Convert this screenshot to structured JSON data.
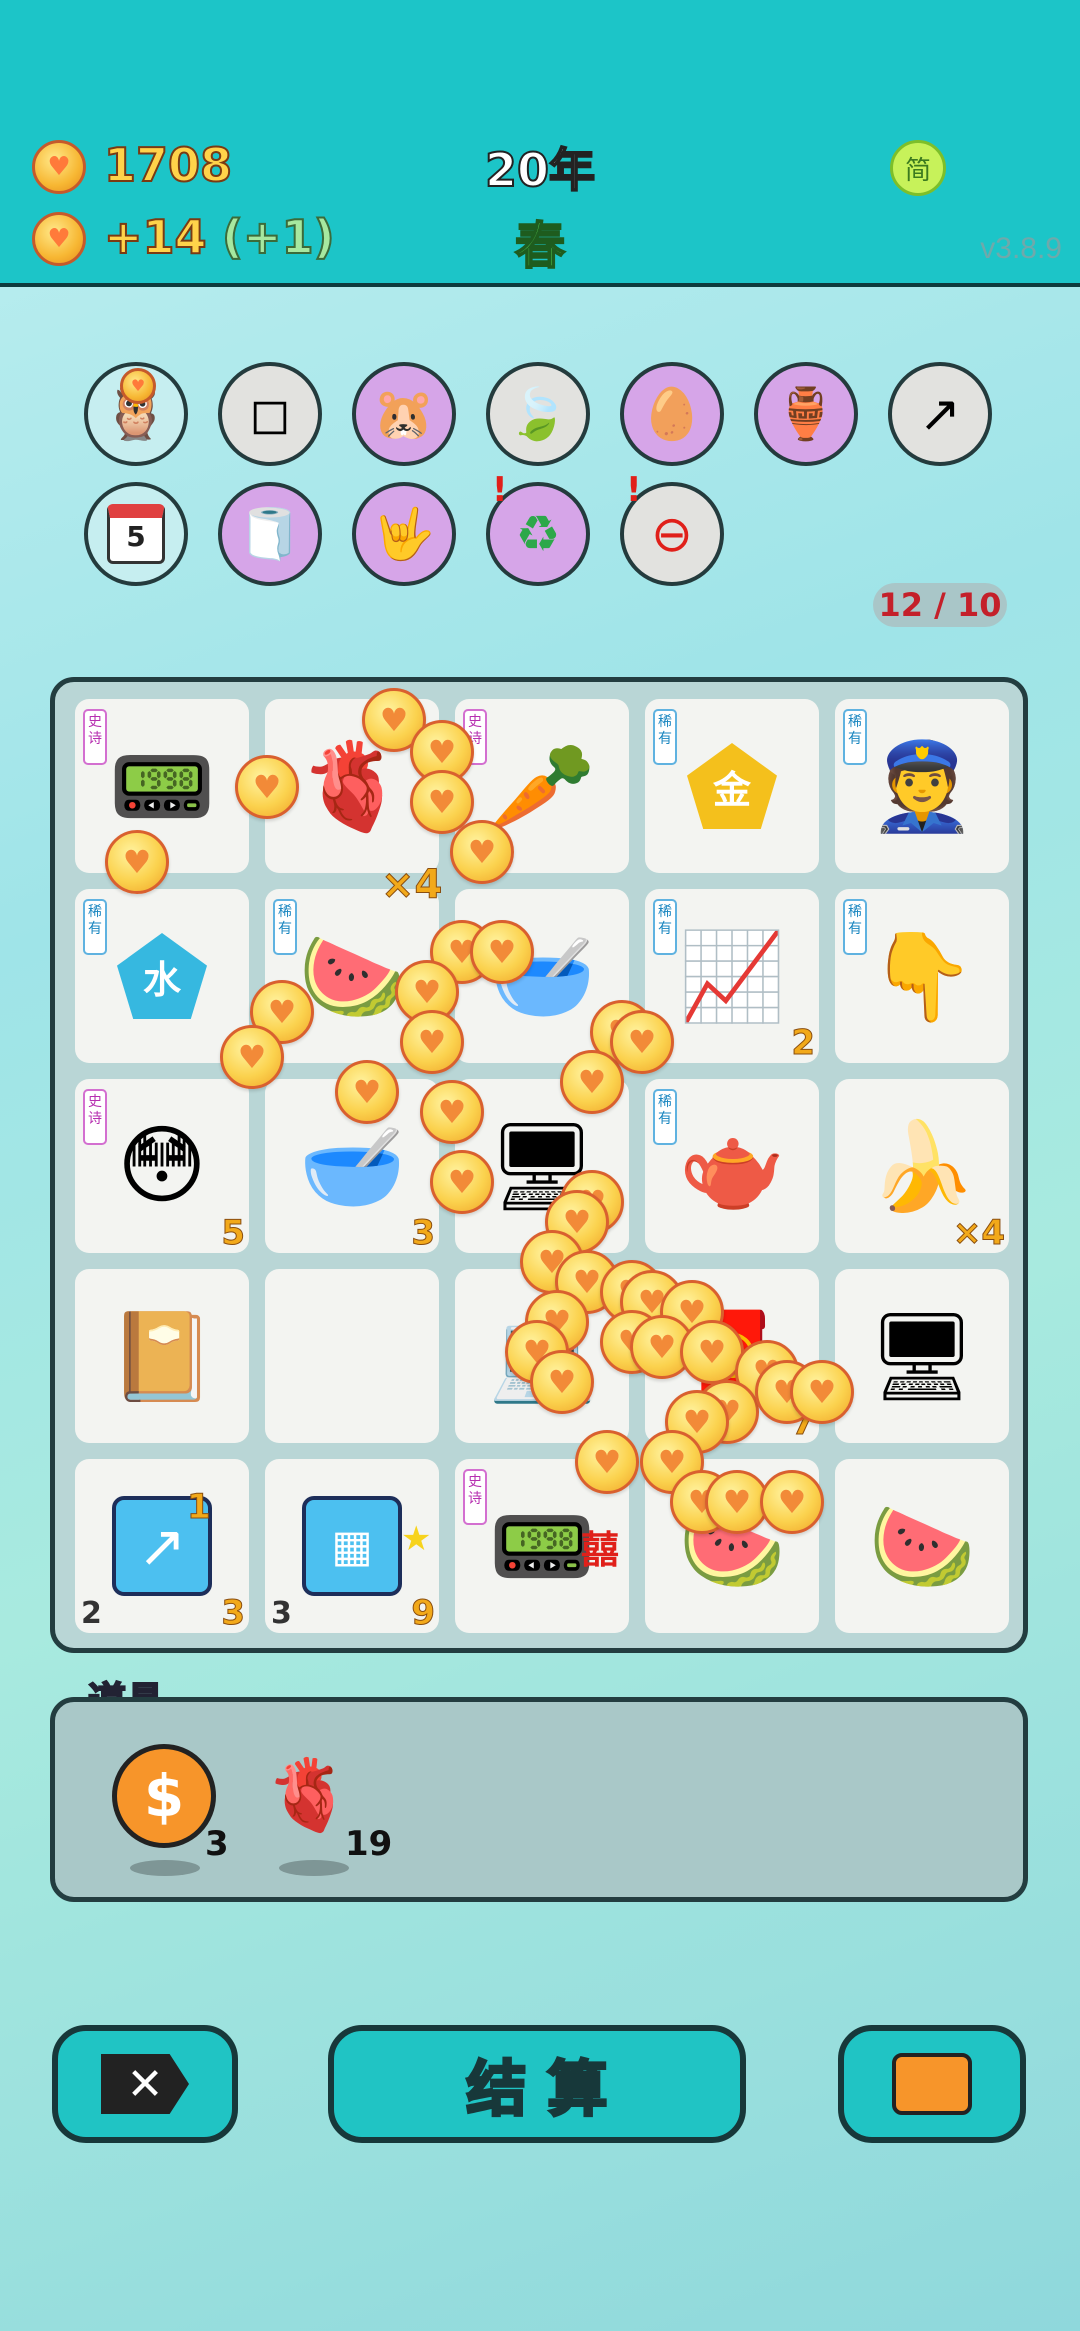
{
  "header": {
    "coins": "1708",
    "income": "+14",
    "bonus": "(+1)",
    "year": "20年",
    "season": "春",
    "lang_icon": "简",
    "version": "v3.8.9"
  },
  "relics_row1": [
    "owl-eyes-icon",
    "sugar-cubes-icon",
    "rabbit-family-icon",
    "leaf-icon",
    "egg-icon",
    "jar-icon",
    "arrow-up-icon"
  ],
  "relics_row2": [
    "calendar-icon",
    "tissue-box-icon",
    "rock-hand-icon",
    "recycle-icon",
    "minus-icon"
  ],
  "calendar_day": "5",
  "slot_counter": "12 / 10",
  "board": {
    "tags": {
      "epic": "史诗",
      "rare": "稀有"
    },
    "multiplier_x4": "×4",
    "cells": [
      {
        "icon": "gpu-icon",
        "tag": "epic"
      },
      {
        "icon": "liver-icon"
      },
      {
        "icon": "carrot-icon",
        "tag": "epic"
      },
      {
        "icon": "gold-pentagon-icon",
        "tag": "rare",
        "label": "金"
      },
      {
        "icon": "police-icon",
        "tag": "rare"
      },
      {
        "icon": "water-pentagon-icon",
        "tag": "rare",
        "label": "水"
      },
      {
        "icon": "watermelon-icon",
        "tag": "rare"
      },
      {
        "icon": "bowl-icon"
      },
      {
        "icon": "growth-chart-icon",
        "tag": "rare",
        "count": "2"
      },
      {
        "icon": "pointing-hand-icon",
        "tag": "rare"
      },
      {
        "icon": "face-icon",
        "tag": "epic",
        "count": "5"
      },
      {
        "icon": "bowl-icon",
        "count": "3"
      },
      {
        "icon": "computer-tower-icon"
      },
      {
        "icon": "teapot-icon",
        "tag": "rare"
      },
      {
        "icon": "banana-icon",
        "count": "×4"
      },
      {
        "icon": "book-icon"
      },
      {
        "icon": "empty-icon"
      },
      {
        "icon": "desktop-pc-icon"
      },
      {
        "icon": "fortune-icon",
        "count": "7"
      },
      {
        "icon": "desktop-pc-icon"
      },
      {
        "icon": "chart-card-icon",
        "count": "3",
        "left": "2",
        "extra": "1"
      },
      {
        "icon": "gold-bars-icon",
        "count": "9",
        "left": "3"
      },
      {
        "icon": "gpu-icon",
        "tag": "epic",
        "label": "囍"
      },
      {
        "icon": "watermelon-icon"
      },
      {
        "icon": "watermelon-icon"
      }
    ]
  },
  "props": {
    "title": "道具",
    "items": [
      {
        "icon": "dollar-coin-icon",
        "count": "3"
      },
      {
        "icon": "liver-icon",
        "count": "19"
      }
    ]
  },
  "buttons": {
    "settle": "结 算"
  }
}
